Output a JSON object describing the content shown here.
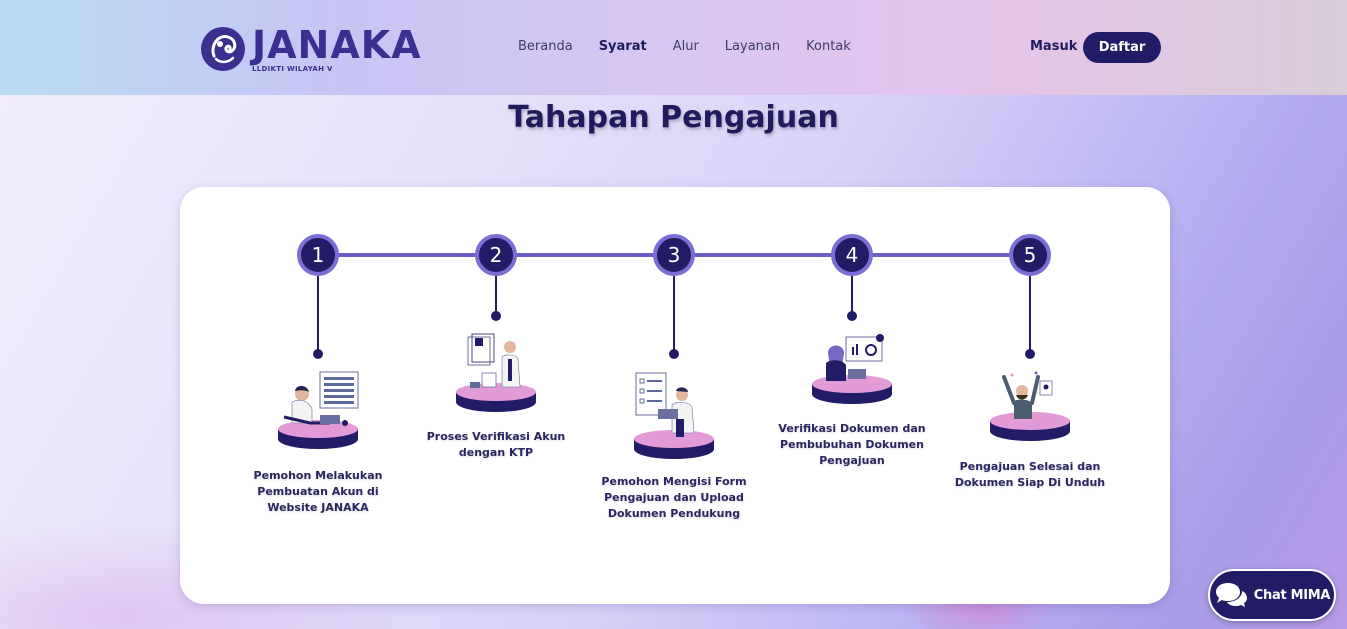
{
  "brand": {
    "name": "JANAKA",
    "subtitle": "LLDIKTI WILAYAH V",
    "logo_icon": "janaka-logo-icon"
  },
  "nav": {
    "items": [
      {
        "label": "Beranda",
        "active": false
      },
      {
        "label": "Syarat",
        "active": true
      },
      {
        "label": "Alur",
        "active": false
      },
      {
        "label": "Layanan",
        "active": false
      },
      {
        "label": "Kontak",
        "active": false
      }
    ]
  },
  "auth": {
    "login_label": "Masuk",
    "register_label": "Daftar"
  },
  "section": {
    "title": "Tahapan Pengajuan"
  },
  "steps": [
    {
      "number": "1",
      "label": "Pemohon Melakukan Pembuatan Akun di Website JANAKA",
      "illustration": "create-account-illustration"
    },
    {
      "number": "2",
      "label": "Proses Verifikasi Akun dengan KTP",
      "illustration": "verify-ktp-illustration"
    },
    {
      "number": "3",
      "label": "Pemohon Mengisi Form Pengajuan dan Upload Dokumen Pendukung",
      "illustration": "fill-form-illustration"
    },
    {
      "number": "4",
      "label": "Verifikasi Dokumen dan Pembubuhan Dokumen Pengajuan",
      "illustration": "verify-document-illustration"
    },
    {
      "number": "5",
      "label": "Pengajuan Selesai dan Dokumen Siap Di Unduh",
      "illustration": "completed-illustration"
    }
  ],
  "chat": {
    "label": "Chat MIMA",
    "icon": "chat-bubbles-icon"
  },
  "colors": {
    "primary": "#221c66",
    "accent": "#6b5fc7",
    "pink": "#e39bd8"
  }
}
